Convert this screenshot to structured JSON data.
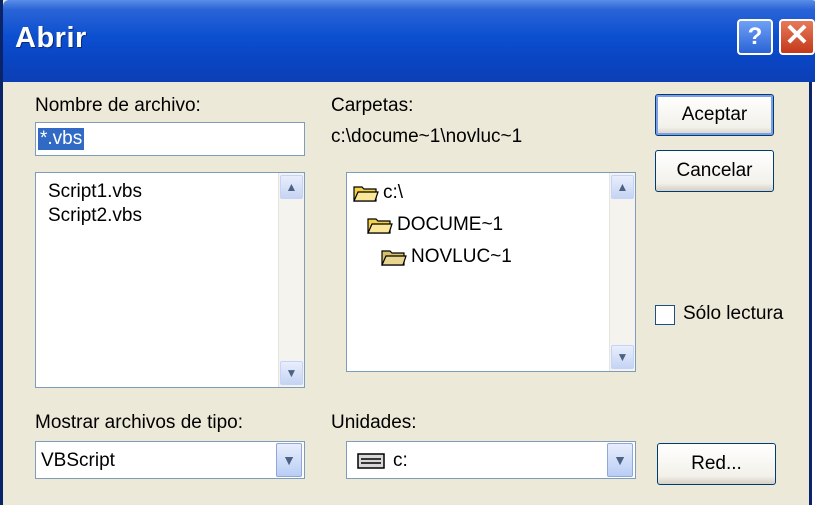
{
  "window": {
    "title": "Abrir",
    "help_label": "?",
    "close_label": "✕"
  },
  "filename": {
    "label": "Nombre de archivo:",
    "value": "*.vbs",
    "files": [
      "Script1.vbs",
      "Script2.vbs"
    ]
  },
  "folders": {
    "label": "Carpetas:",
    "current_path": "c:\\docume~1\\novluc~1",
    "tree": [
      "c:\\",
      "DOCUME~1",
      "NOVLUC~1"
    ]
  },
  "buttons": {
    "accept": "Aceptar",
    "cancel": "Cancelar",
    "network": "Red..."
  },
  "readonly": {
    "label": "Sólo lectura",
    "checked": false
  },
  "filetype": {
    "label": "Mostrar archivos de tipo:",
    "selected": "VBScript"
  },
  "drives": {
    "label": "Unidades:",
    "selected": "c:"
  },
  "icons": {
    "help": "question-icon",
    "close": "close-icon",
    "folder": "folder-icon",
    "drive": "drive-icon"
  }
}
